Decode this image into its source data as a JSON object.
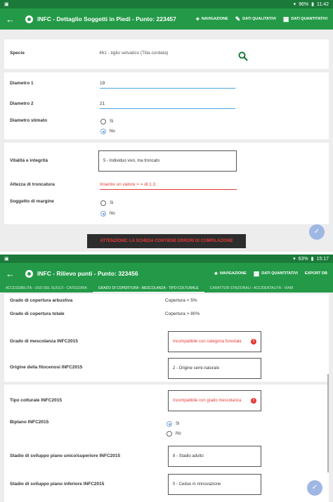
{
  "screen1": {
    "status": {
      "time": "11:42",
      "battery": "96%"
    },
    "toolbar": {
      "title": "INFC - Dettaglio Soggetti in Piedi - Punto: 223457",
      "nav_label": "NAVIGAZIONE",
      "qual_label": "DATI QUALITATIVI",
      "quant_label": "DATI QUANTITATIVI"
    },
    "specie": {
      "label": "Specie",
      "value": "461 - tiglio selvatico (Tilia cordata)"
    },
    "diametro1": {
      "label": "Diametro 1",
      "value": "19"
    },
    "diametro2": {
      "label": "Diametro 2",
      "value": "21"
    },
    "diametro_stimato": {
      "label": "Diametro stimato",
      "options": [
        "Si",
        "No"
      ],
      "selected": "No"
    },
    "vitalita": {
      "label": "Vitalità e integrità",
      "value": "5 - Individuo vivo, ma troncato"
    },
    "altezza": {
      "label": "Altezza di troncatura",
      "value": "Inserire un valore > = di 1.3"
    },
    "margine": {
      "label": "Soggetto di margine",
      "options": [
        "Si",
        "No"
      ],
      "selected": "No"
    },
    "toast": "ATTENZIONE: LA SCHEDA CONTIENE ERRORI DI COMPILAZIONE"
  },
  "screen2": {
    "status": {
      "time": "15:17",
      "battery": "63%"
    },
    "toolbar": {
      "title": "INFC - Rilievo punti - Punto: 323456",
      "nav_label": "NAVIGAZIONE",
      "quant_label": "DATI QUANTITATIVI",
      "export_label": "EXPORT DB"
    },
    "tabs": [
      "ACCESSIBILITÀ - USO DEL SUOLO - CATEGORIA",
      "GRADO DI COPERTURA - MESCOLANZA - TIPO COLTURALE",
      "CARATTERI STAZIONALI - ACCIDENTALITÀ - VIABI"
    ],
    "active_tab": 1,
    "copertura_arbustiva": {
      "label": "Grado di copertura arbustiva",
      "value": "Copertura < 5%"
    },
    "copertura_totale": {
      "label": "Grado di copertura totale",
      "value": "Copertura > 80%"
    },
    "mescolanza": {
      "label": "Grado di mescolanza INFC2015",
      "value": "Incompatibile con categoria forestale"
    },
    "origine": {
      "label": "Origine della fitocenosi INFC2015",
      "value": "2 - Origine semi-naturale"
    },
    "tipo_colturale": {
      "label": "Tipo colturale INFC2015",
      "value": "Incompatibile con grado mescolanza"
    },
    "biplano": {
      "label": "Biplano INFC2015",
      "options": [
        "Si",
        "No"
      ],
      "selected": "Si"
    },
    "stadio_unico": {
      "label": "Stadio di sviluppo piano unico/superiore INFC2015",
      "value": "8 - Stadio adulto"
    },
    "stadio_inferiore": {
      "label": "Stadio di sviluppo piano inferiore INFC2015",
      "value": "0 - Ceduo in rinnovazione"
    }
  },
  "icons": {
    "back": "arrow-left-icon",
    "check": "check-icon",
    "search": "search-icon",
    "error": "error-icon"
  },
  "colors": {
    "primary": "#249a48",
    "statusbar": "#1b7a3a",
    "error": "#e53935",
    "accent": "#4aa3df"
  }
}
